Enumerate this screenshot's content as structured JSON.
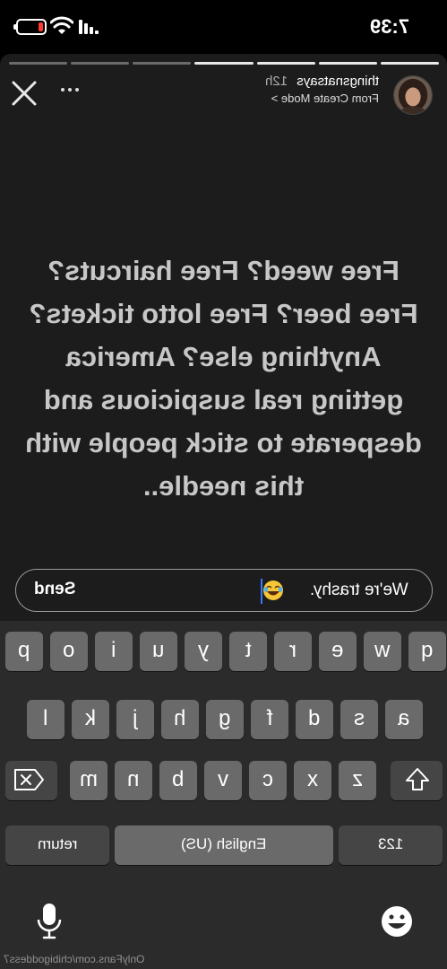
{
  "status_bar": {
    "time": "7:39",
    "battery_color": "#ff3b30",
    "battery_level": 0.2
  },
  "story": {
    "progress_total": 7,
    "progress_done": 4,
    "username": "thingsnatsays",
    "age": "12h",
    "subtitle": "From Create Mode >",
    "text": "Free weed? Free haircuts? Free beer? Free lotto tickets? Anything else? America getting real suspicious and desperate to stick people with this needle..",
    "close_icon": "close-icon",
    "more_icon": "more-icon"
  },
  "reply": {
    "text": "We're trashy.",
    "emoji": "laughing-emoji",
    "send_label": "Send"
  },
  "keyboard": {
    "row1": [
      "q",
      "w",
      "e",
      "r",
      "t",
      "y",
      "u",
      "i",
      "o",
      "p"
    ],
    "row2": [
      "a",
      "s",
      "d",
      "f",
      "g",
      "h",
      "j",
      "k",
      "l"
    ],
    "row3": [
      "z",
      "x",
      "c",
      "v",
      "b",
      "n",
      "m"
    ],
    "numbers_label": "123",
    "space_label": "English (US)",
    "return_label": "return"
  },
  "watermark": "OnlyFans.com/chibigoddess7"
}
